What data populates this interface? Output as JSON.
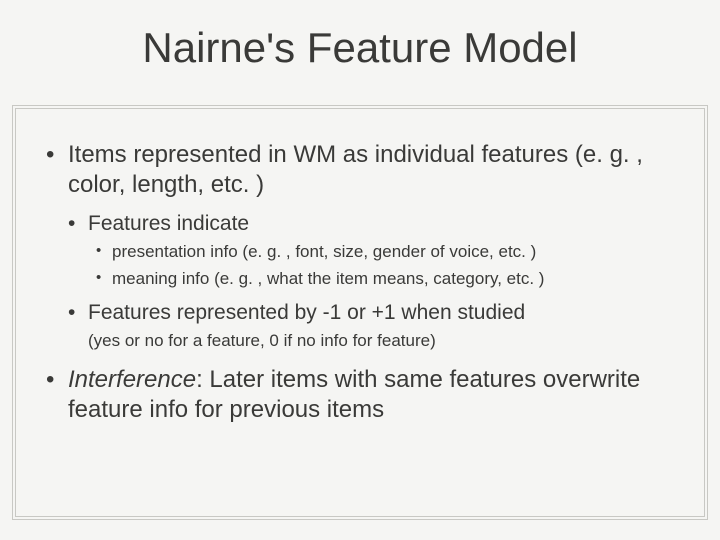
{
  "title": "Nairne's Feature Model",
  "bullets": {
    "b1": "Items represented in WM as individual features (e. g. , color, length, etc. )",
    "b1a": "Features indicate",
    "b1a1": "presentation info (e. g. , font, size, gender of voice, etc. )",
    "b1a2": "meaning info (e. g. , what the item means, category, etc. )",
    "b1b": "Features represented by -1 or +1 when studied",
    "b1b_note": "(yes or no for a feature, 0 if no info for feature)",
    "b2_prefix": "Interference",
    "b2_rest": ": Later items with same features overwrite feature info for previous items"
  }
}
